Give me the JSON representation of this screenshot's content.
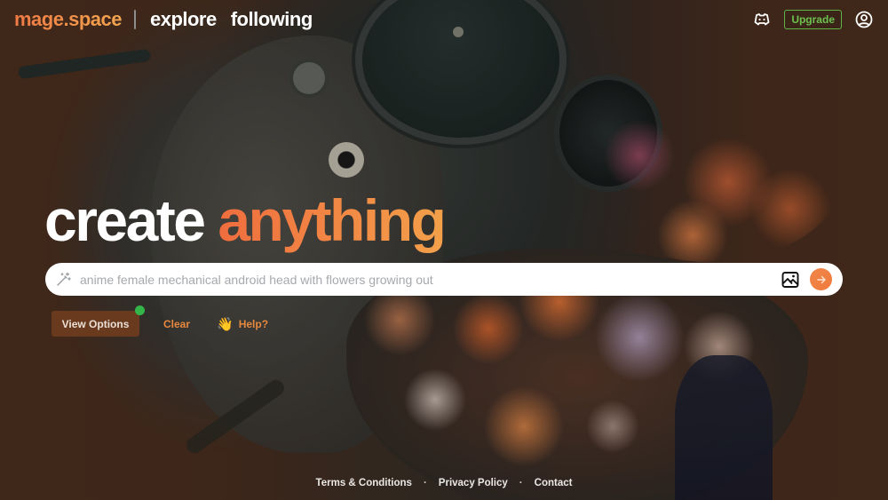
{
  "header": {
    "logo": "mage.space",
    "nav": [
      {
        "label": "explore"
      },
      {
        "label": "following"
      }
    ],
    "discord_icon": "discord-icon",
    "upgrade_label": "Upgrade",
    "account_icon": "user-circle-icon"
  },
  "hero": {
    "title_white": "create",
    "title_accent": "anything"
  },
  "prompt": {
    "value": "",
    "placeholder": "anime female mechanical android head with flowers growing out",
    "wand_icon": "magic-wand-icon",
    "image_icon": "image-upload-icon",
    "submit_icon": "arrow-right-icon"
  },
  "actions": {
    "view_options_label": "View Options",
    "clear_label": "Clear",
    "help_emoji": "👋",
    "help_label": "Help?"
  },
  "footer": {
    "links": [
      {
        "label": "Terms & Conditions"
      },
      {
        "label": "Privacy Policy"
      },
      {
        "label": "Contact"
      }
    ],
    "separator": "·"
  },
  "colors": {
    "accent_orange": "#f07a45",
    "upgrade_green": "#62b24a",
    "status_dot_green": "#33b54a",
    "background_brown": "#4d2f1f"
  }
}
